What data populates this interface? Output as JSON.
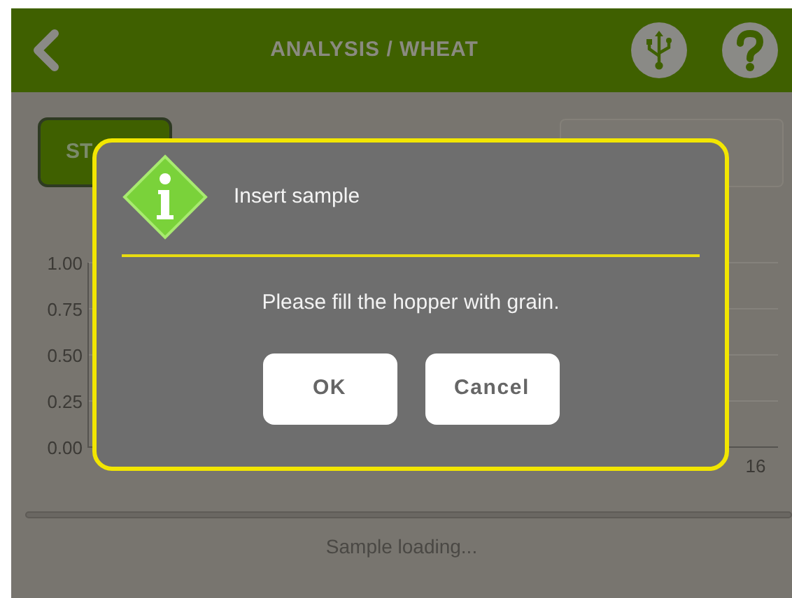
{
  "header": {
    "title": "ANALYSIS / WHEAT"
  },
  "start_button": {
    "label": "ST"
  },
  "chart_axis": {
    "yticks": [
      "1.00",
      "0.75",
      "0.50",
      "0.25",
      "0.00"
    ],
    "xticks": [
      "16"
    ]
  },
  "status": "Sample loading...",
  "dialog": {
    "title": "Insert sample",
    "message": "Please fill the hopper with grain.",
    "buttons": [
      "OK",
      "Cancel"
    ]
  }
}
